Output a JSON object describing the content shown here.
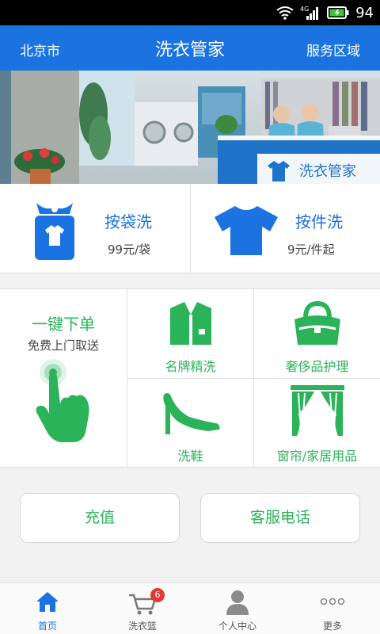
{
  "status_bar": {
    "network": "4G",
    "battery": "94"
  },
  "header": {
    "city": "北京市",
    "title": "洗衣管家",
    "service_area": "服务区域"
  },
  "banner": {
    "sign_text": "洗衣管家"
  },
  "laundry_types": [
    {
      "title": "按袋洗",
      "price": "99元/袋"
    },
    {
      "title": "按件洗",
      "price": "9元/件起"
    }
  ],
  "one_click": {
    "title": "一键下单",
    "subtitle": "免费上门取送"
  },
  "services": [
    {
      "label": "名牌精洗",
      "icon": "shirt-suit-icon"
    },
    {
      "label": "奢侈品护理",
      "icon": "handbag-icon"
    },
    {
      "label": "洗鞋",
      "icon": "high-heel-icon"
    },
    {
      "label": "窗帘/家居用品",
      "icon": "curtain-icon"
    }
  ],
  "buttons": {
    "recharge": "充值",
    "customer_service": "客服电话"
  },
  "nav": [
    {
      "label": "首页",
      "icon": "home-icon",
      "active": true
    },
    {
      "label": "洗衣篮",
      "icon": "cart-icon",
      "badge": "6"
    },
    {
      "label": "个人中心",
      "icon": "person-icon"
    },
    {
      "label": "更多",
      "icon": "more-icon"
    }
  ],
  "colors": {
    "primary_blue": "#1a73e0",
    "accent_green": "#2bb35a",
    "badge_red": "#e53935"
  }
}
